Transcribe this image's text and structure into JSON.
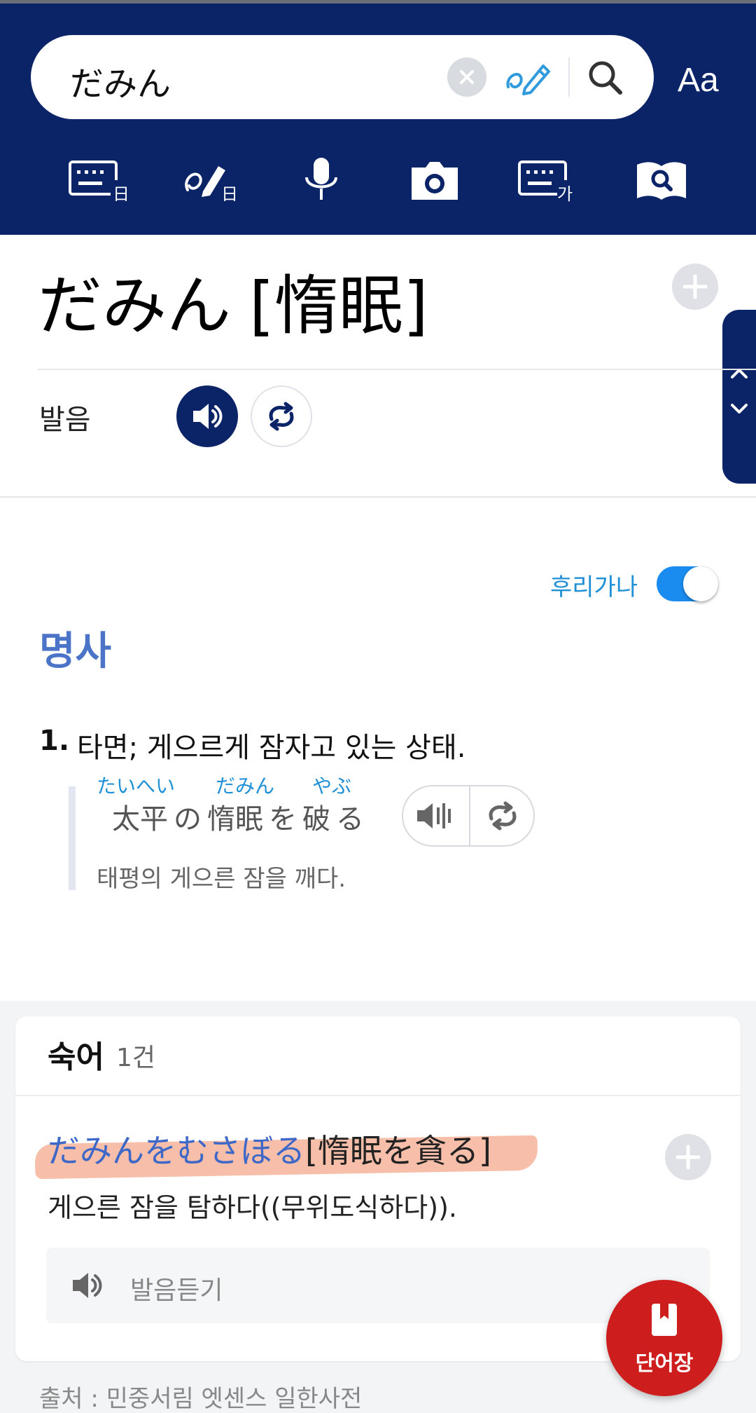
{
  "search": {
    "query": "だみん",
    "font_size_button": "Aa"
  },
  "toolbar": {
    "tools": [
      "keyboard-japanese-icon",
      "handwriting-japanese-icon",
      "microphone-icon",
      "camera-icon",
      "keyboard-korean-icon",
      "dictionary-search-icon"
    ]
  },
  "entry": {
    "word": "だみん",
    "kanji": "[惰眠]",
    "pronunciation_label": "발음",
    "furigana_label": "후리가나",
    "furigana_on": true,
    "part_of_speech": "명사",
    "definitions": [
      {
        "number": "1.",
        "text": "타면; 게으르게 잠자고 있는 상태.",
        "example": {
          "ruby": [
            "たいへい",
            "だみん",
            "やぶ"
          ],
          "tokens": [
            "太平",
            "の",
            "惰眠",
            "を",
            "破",
            "る"
          ],
          "translation": "태평의 게으른 잠을 깨다."
        }
      }
    ]
  },
  "idioms": {
    "title": "숙어",
    "count": "1건",
    "items": [
      {
        "kana": "だみんをむさぼる",
        "kanji": "[惰眠を貪る]",
        "meaning": "게으른 잠을 탐하다((무위도식하다)).",
        "listen_label": "발음듣기"
      }
    ]
  },
  "source": "출처 : 민중서림 엣센스 일한사전",
  "wordbook_label": "단어장",
  "colors": {
    "header_bg": "#0b2367",
    "accent_blue": "#1f8fd6",
    "pos_blue": "#4b73c8",
    "wordbook_red": "#cd1d1d",
    "highlight": "#f6b49b"
  }
}
